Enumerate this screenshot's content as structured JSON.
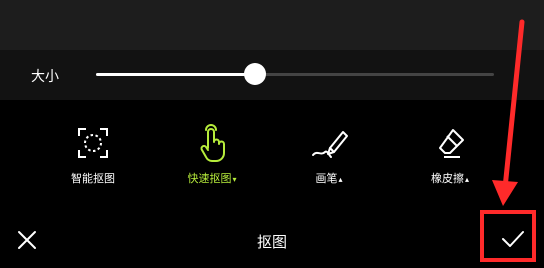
{
  "size_control": {
    "label": "大小",
    "value_fraction": 0.4
  },
  "tools": [
    {
      "label": "智能抠图",
      "icon": "smart-cutout-icon",
      "caret": ""
    },
    {
      "label": "快速抠图",
      "icon": "tap-finger-icon",
      "caret": "▾",
      "active": true
    },
    {
      "label": "画笔",
      "icon": "brush-icon",
      "caret": "▴"
    },
    {
      "label": "橡皮擦",
      "icon": "eraser-icon",
      "caret": "▴"
    }
  ],
  "bottom_bar": {
    "title": "抠图",
    "close_icon": "close-icon",
    "confirm_icon": "check-icon"
  },
  "colors": {
    "accent": "#b6ec3b",
    "highlight": "#ff2a2a"
  }
}
